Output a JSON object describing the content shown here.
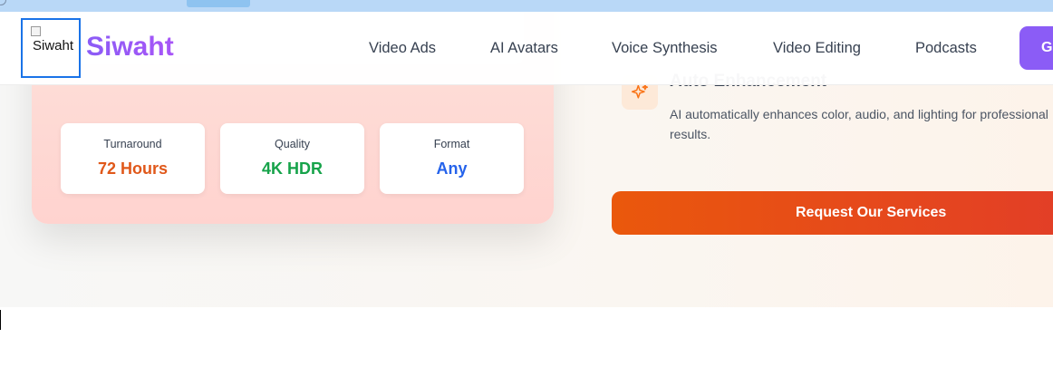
{
  "header": {
    "logo_alt": "Siwaht",
    "brand": "Siwaht",
    "nav": [
      "Video Ads",
      "AI Avatars",
      "Voice Synthesis",
      "Video Editing",
      "Podcasts"
    ],
    "cta_label": "G"
  },
  "stats": [
    {
      "label": "Turnaround",
      "value": "72 Hours",
      "color": "#e0581a"
    },
    {
      "label": "Quality",
      "value": "4K HDR",
      "color": "#16a34a"
    },
    {
      "label": "Format",
      "value": "Any",
      "color": "#2563eb"
    }
  ],
  "feature": {
    "icon": "sparkles-icon",
    "title": "Auto Enhancement",
    "description": "AI automatically enhances color, audio, and lighting for professional results."
  },
  "cta": {
    "label": "Request Our Services"
  },
  "colors": {
    "brand": "#8b5cf6",
    "cta_start": "#ea580c",
    "cta_end": "#e23d28"
  }
}
